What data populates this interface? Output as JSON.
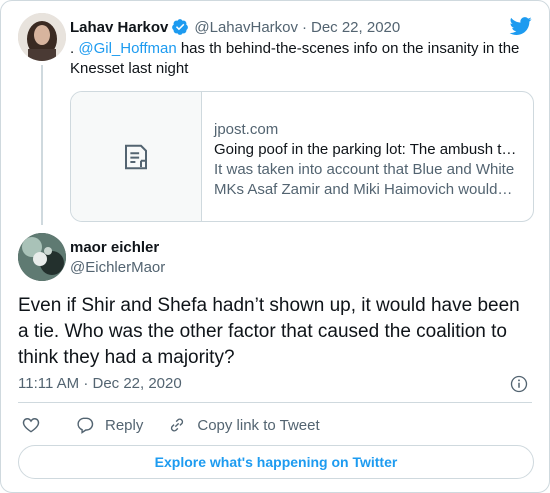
{
  "colors": {
    "accent": "#1d9bf0",
    "text": "#0f1419",
    "muted": "#536471",
    "border": "#cfd9de"
  },
  "parent": {
    "name": "Lahav Harkov",
    "handle": "@LahavHarkov",
    "separator": "·",
    "date": "Dec 22, 2020",
    "text_prefix": ". ",
    "mention": "@Gil_Hoffman",
    "text_rest": " has th behind-the-scenes info on the insanity in the Knesset last night",
    "link": {
      "domain": "jpost.com",
      "title": "Going poof in the parking lot: The ambush that brought down the government",
      "description": "It was taken into account that Blue and White MKs Asaf Zamir and Miki Haimovich would abstain..."
    }
  },
  "tweet": {
    "name": "maor eichler",
    "handle": "@EichlerMaor",
    "text": "Even if Shir and Shefa hadn’t shown up, it would have been a tie. Who was the other factor that caused the coalition to think they had a majority?",
    "time": "11:11 AM · Dec 22, 2020"
  },
  "actions": {
    "reply": "Reply",
    "copy_link": "Copy link to Tweet"
  },
  "icons": [
    "verified-badge-icon",
    "twitter-bird-icon",
    "document-icon",
    "info-icon",
    "heart-icon",
    "reply-icon",
    "link-icon"
  ],
  "explore_button": "Explore what's happening on Twitter"
}
